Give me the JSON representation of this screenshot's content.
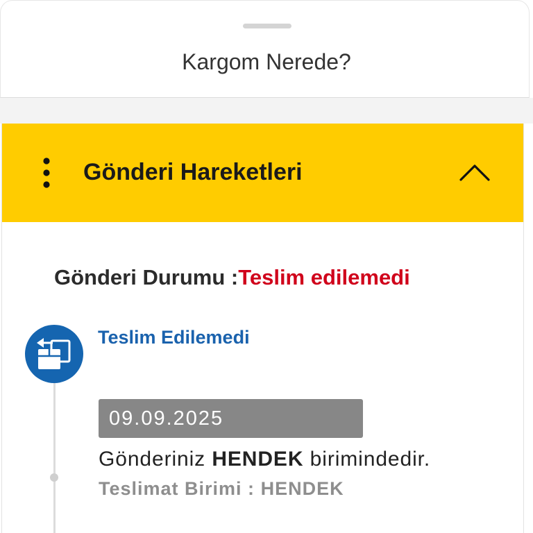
{
  "sheet": {
    "title": "Kargom Nerede?"
  },
  "tracking_panel": {
    "title": "Gönderi Hareketleri",
    "menu_icon": "more-vertical-icon",
    "collapse_icon": "chevron-up-icon",
    "expanded": true
  },
  "shipment_status": {
    "label": "Gönderi Durumu :",
    "value": "Teslim edilemedi"
  },
  "movements": [
    {
      "title": "Teslim Edilemedi",
      "icon": "package-return-icon",
      "date": "09.09.2025",
      "message": {
        "before": "Gönderiniz",
        "highlight": "HENDEK",
        "after": "birimindedir."
      },
      "unit": {
        "label": "Teslimat Birimi :",
        "value": "HENDEK"
      }
    }
  ],
  "colors": {
    "panel_header": "#FFCC00",
    "status_value": "#D0021B",
    "event_accent": "#1565B0",
    "date_badge": "#878787",
    "secondary_text": "#8E8E8E"
  }
}
